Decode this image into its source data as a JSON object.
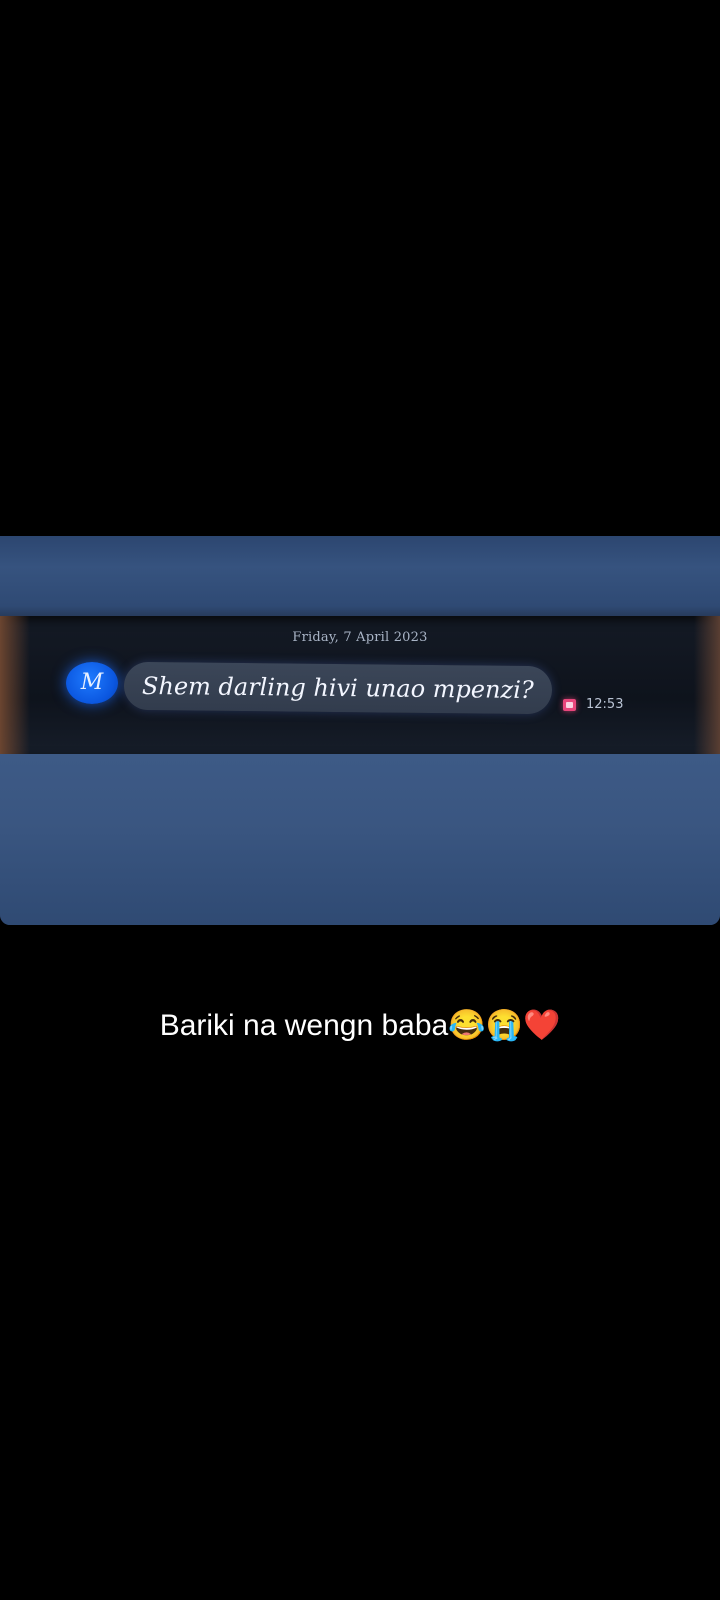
{
  "chat": {
    "date": "Friday, 7 April 2023",
    "avatar_initial": "M",
    "message": "Shem darling hivi unao mpenzi?",
    "time": "12:53"
  },
  "caption": {
    "text": "Bariki na wengn baba😂😭❤️"
  },
  "colors": {
    "avatar": "#0b57e0",
    "bubble": "#36404f",
    "status_icon": "#e9467c",
    "background": "#000000"
  }
}
